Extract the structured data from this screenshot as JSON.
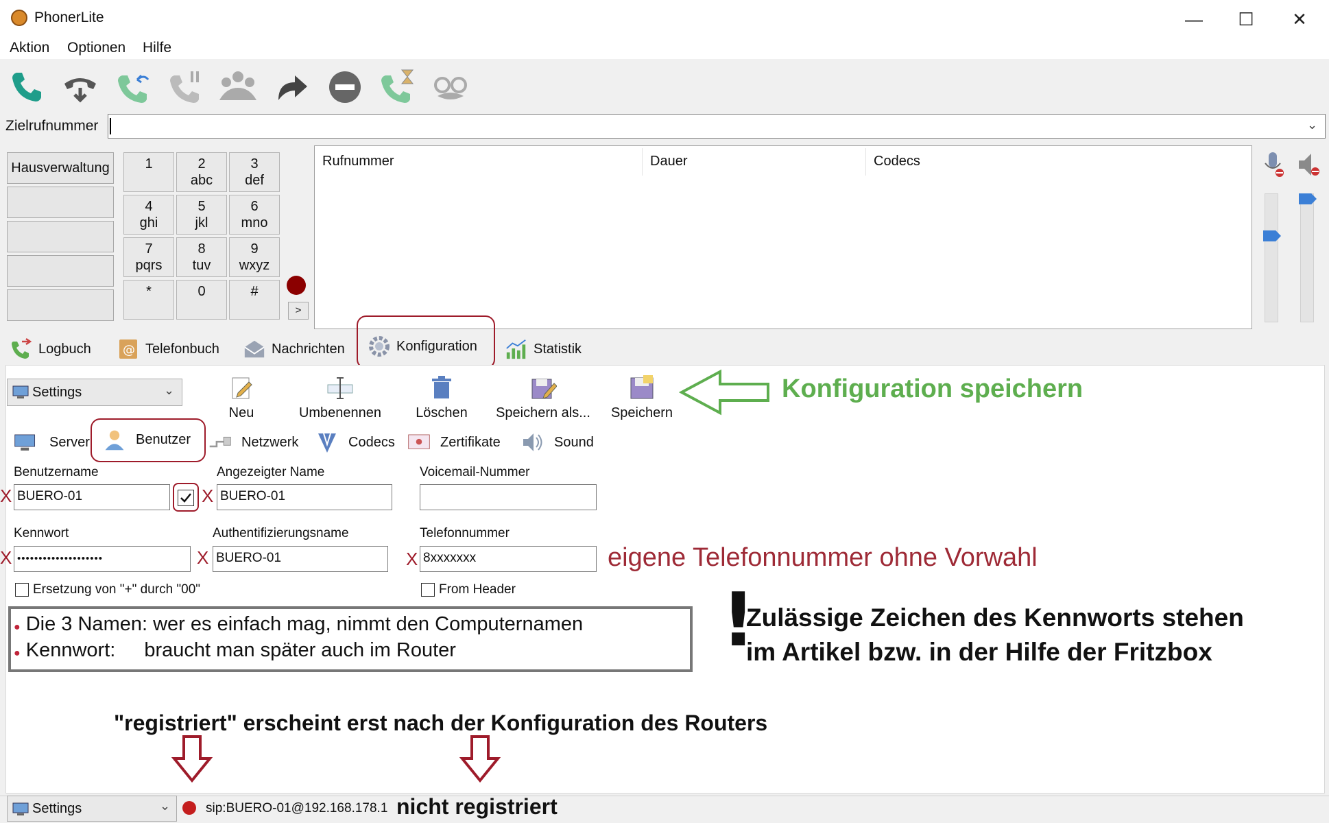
{
  "window": {
    "title": "PhonerLite",
    "minimize": "—",
    "maximize": "☐",
    "close": "✕"
  },
  "menu": [
    "Aktion",
    "Optionen",
    "Hilfe"
  ],
  "toolbar_icons": [
    "call-icon",
    "hangup-icon",
    "callback-icon",
    "hold-icon",
    "conference-icon",
    "forward-icon",
    "dnd-icon",
    "waiting-icon",
    "incognito-icon"
  ],
  "dial": {
    "label": "Zielrufnummer",
    "value": ""
  },
  "quick_dial": [
    "Hausverwaltung",
    "",
    "",
    "",
    ""
  ],
  "keypad": [
    {
      "d": "1",
      "l": ""
    },
    {
      "d": "2",
      "l": "abc"
    },
    {
      "d": "3",
      "l": "def"
    },
    {
      "d": "4",
      "l": "ghi"
    },
    {
      "d": "5",
      "l": "jkl"
    },
    {
      "d": "6",
      "l": "mno"
    },
    {
      "d": "7",
      "l": "pqrs"
    },
    {
      "d": "8",
      "l": "tuv"
    },
    {
      "d": "9",
      "l": "wxyz"
    },
    {
      "d": "*",
      "l": ""
    },
    {
      "d": "0",
      "l": ""
    },
    {
      "d": "#",
      "l": ""
    }
  ],
  "keypad_more": ">",
  "calls": {
    "columns": [
      "Rufnummer",
      "Dauer",
      "Codecs"
    ]
  },
  "main_tabs": [
    "Logbuch",
    "Telefonbuch",
    "Nachrichten",
    "Konfiguration",
    "Statistik"
  ],
  "config": {
    "profile": "Settings",
    "tools": [
      "Neu",
      "Umbenennen",
      "Löschen",
      "Speichern als...",
      "Speichern"
    ],
    "sub_tabs": [
      "Server",
      "Benutzer",
      "Netzwerk",
      "Codecs",
      "Zertifikate",
      "Sound"
    ]
  },
  "fields": {
    "benutzername": {
      "label": "Benutzername",
      "value": "BUERO-01"
    },
    "angezeigter_name": {
      "label": "Angezeigter Name",
      "value": "BUERO-01"
    },
    "voicemail": {
      "label": "Voicemail-Nummer",
      "value": ""
    },
    "kennwort": {
      "label": "Kennwort",
      "value": "••••••••••••••••••••"
    },
    "auth_name": {
      "label": "Authentifizierungsname",
      "value": "BUERO-01"
    },
    "telefonnummer": {
      "label": "Telefonnummer",
      "value": "8xxxxxxx"
    },
    "ersetzung": {
      "label": "Ersetzung von \"+\" durch \"00\"",
      "checked": false
    },
    "from_header": {
      "label": "From Header",
      "checked": false
    }
  },
  "annotations": {
    "x_mark": "X",
    "save_hint": "Konfiguration speichern",
    "phone_hint": "eigene Telefonnummer ohne Vorwahl",
    "note_line1_a": "Die 3 Namen:",
    "note_line1_b": "wer es einfach mag, nimmt den Computernamen",
    "note_line2_a": "Kennwort:",
    "note_line2_b": "braucht man später auch im Router",
    "exclaim": "!",
    "password_hint_1": "Zulässige Zeichen des Kennworts stehen",
    "password_hint_2": "im Artikel bzw. in der Hilfe der Fritzbox",
    "registered_hint": "\"registriert\" erscheint erst nach der Konfiguration des Routers"
  },
  "status": {
    "profile": "Settings",
    "sip": "sip:BUERO-01@192.168.178.1",
    "state": "nicht registriert"
  },
  "colors": {
    "green": "#5eae4f",
    "annotation_red": "#9e1b2a",
    "phone_green": "#1f9d8a",
    "slider_blue": "#3b7fd6"
  }
}
